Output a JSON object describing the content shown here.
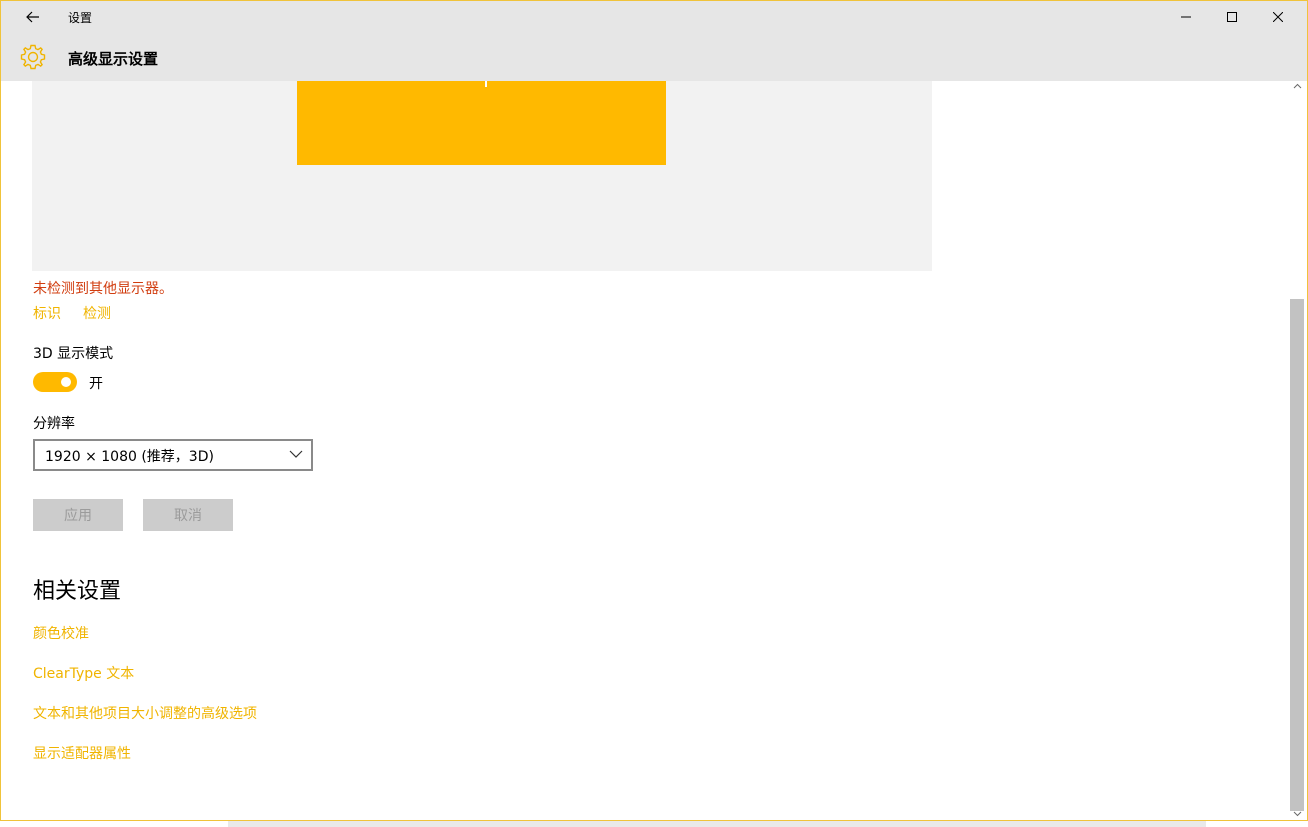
{
  "window": {
    "title": "设置",
    "accent_color": "#ffb900"
  },
  "header": {
    "title": "高级显示设置",
    "icon": "gear-icon"
  },
  "display": {
    "warning": "未检测到其他显示器。",
    "identify_link": "标识",
    "detect_link": "检测"
  },
  "mode_3d": {
    "label": "3D 显示模式",
    "state_label": "开",
    "enabled": true
  },
  "resolution": {
    "label": "分辨率",
    "selected": "1920 × 1080 (推荐，3D)"
  },
  "actions": {
    "apply": "应用",
    "cancel": "取消"
  },
  "related": {
    "heading": "相关设置",
    "links": [
      "颜色校准",
      "ClearType 文本",
      "文本和其他项目大小调整的高级选项",
      "显示适配器属性"
    ]
  }
}
